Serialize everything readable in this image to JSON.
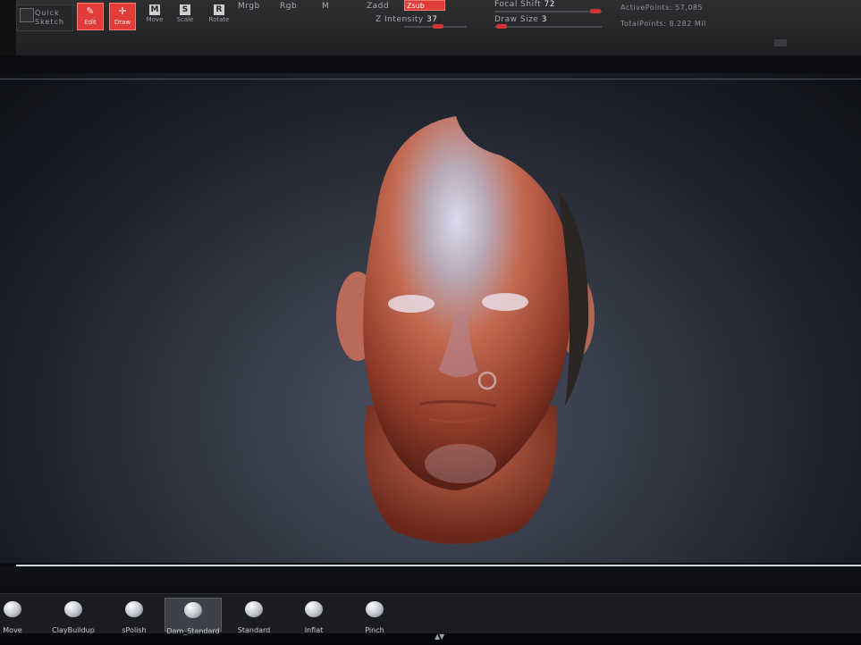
{
  "toolbar": {
    "quick_sketch_line1": "Quick",
    "quick_sketch_line2": "Sketch",
    "edit_label": "Edit",
    "draw_label": "Draw",
    "move_label": "Move",
    "scale_label": "Scale",
    "rotate_label": "Rotate",
    "move_key": "M",
    "scale_key": "S",
    "rotate_key": "R",
    "mrgb": "Mrgb",
    "rgb": "Rgb",
    "m": "M",
    "zadd": "Zadd",
    "zsub": "Zsub",
    "z_intensity_label": "Z Intensity",
    "z_intensity_value": "37",
    "focal_shift_label": "Focal Shift",
    "focal_shift_value": "72",
    "draw_size_label": "Draw Size",
    "draw_size_value": "3",
    "active_points": "ActivePoints: 57,085",
    "total_points": "TotalPoints: 8.282 Mil"
  },
  "brushes": [
    {
      "label": "Move"
    },
    {
      "label": "ClayBuildup"
    },
    {
      "label": "sPolish"
    },
    {
      "label": "Dam_Standard",
      "selected": true
    },
    {
      "label": "Standard"
    },
    {
      "label": "Inflat"
    },
    {
      "label": "Pinch"
    }
  ],
  "colors": {
    "accent": "#e13b3a",
    "skin": "#c2634a",
    "viewport_bg": "#343946"
  },
  "sliders": {
    "z_intensity": 0.37,
    "focal_shift": 0.72,
    "draw_size": 0.03
  }
}
